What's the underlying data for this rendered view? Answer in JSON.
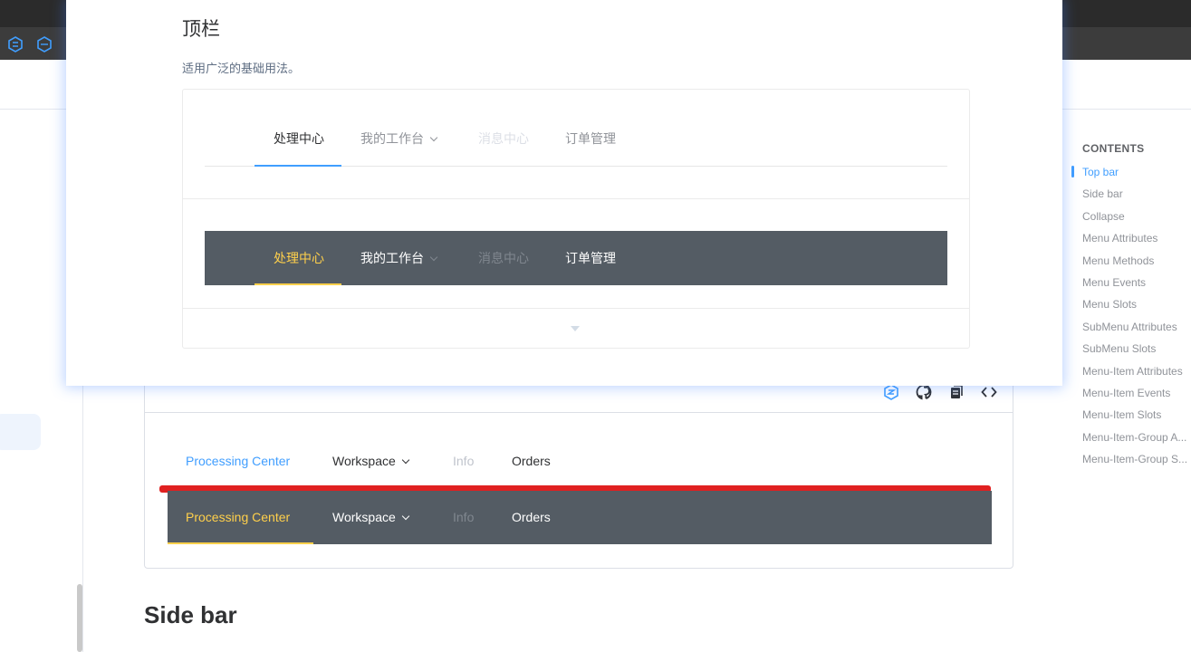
{
  "toc": {
    "title": "CONTENTS",
    "items": [
      {
        "label": "Top bar",
        "active": true
      },
      {
        "label": "Side bar"
      },
      {
        "label": "Collapse"
      },
      {
        "label": "Menu Attributes"
      },
      {
        "label": "Menu Methods"
      },
      {
        "label": "Menu Events"
      },
      {
        "label": "Menu Slots"
      },
      {
        "label": "SubMenu Attributes"
      },
      {
        "label": "SubMenu Slots"
      },
      {
        "label": "Menu-Item Attributes"
      },
      {
        "label": "Menu-Item Events"
      },
      {
        "label": "Menu-Item Slots"
      },
      {
        "label": "Menu-Item-Group A..."
      },
      {
        "label": "Menu-Item-Group S..."
      }
    ]
  },
  "demo": {
    "toolbar_icons": [
      "element-playground-icon",
      "github-icon",
      "copy-icon",
      "code-icon"
    ],
    "menu": {
      "items": [
        "Processing Center",
        "Workspace",
        "Info",
        "Orders"
      ]
    }
  },
  "section_heading": "Side bar",
  "modal": {
    "title": "顶栏",
    "description": "适用广泛的基础用法。",
    "menu": {
      "items": [
        "处理中心",
        "我的工作台",
        "消息中心",
        "订单管理"
      ]
    }
  },
  "colors": {
    "primary": "#409eff",
    "dark_menu_bg": "#545c64",
    "dark_menu_active": "#ffd04b",
    "highlight_red": "#e02020"
  }
}
